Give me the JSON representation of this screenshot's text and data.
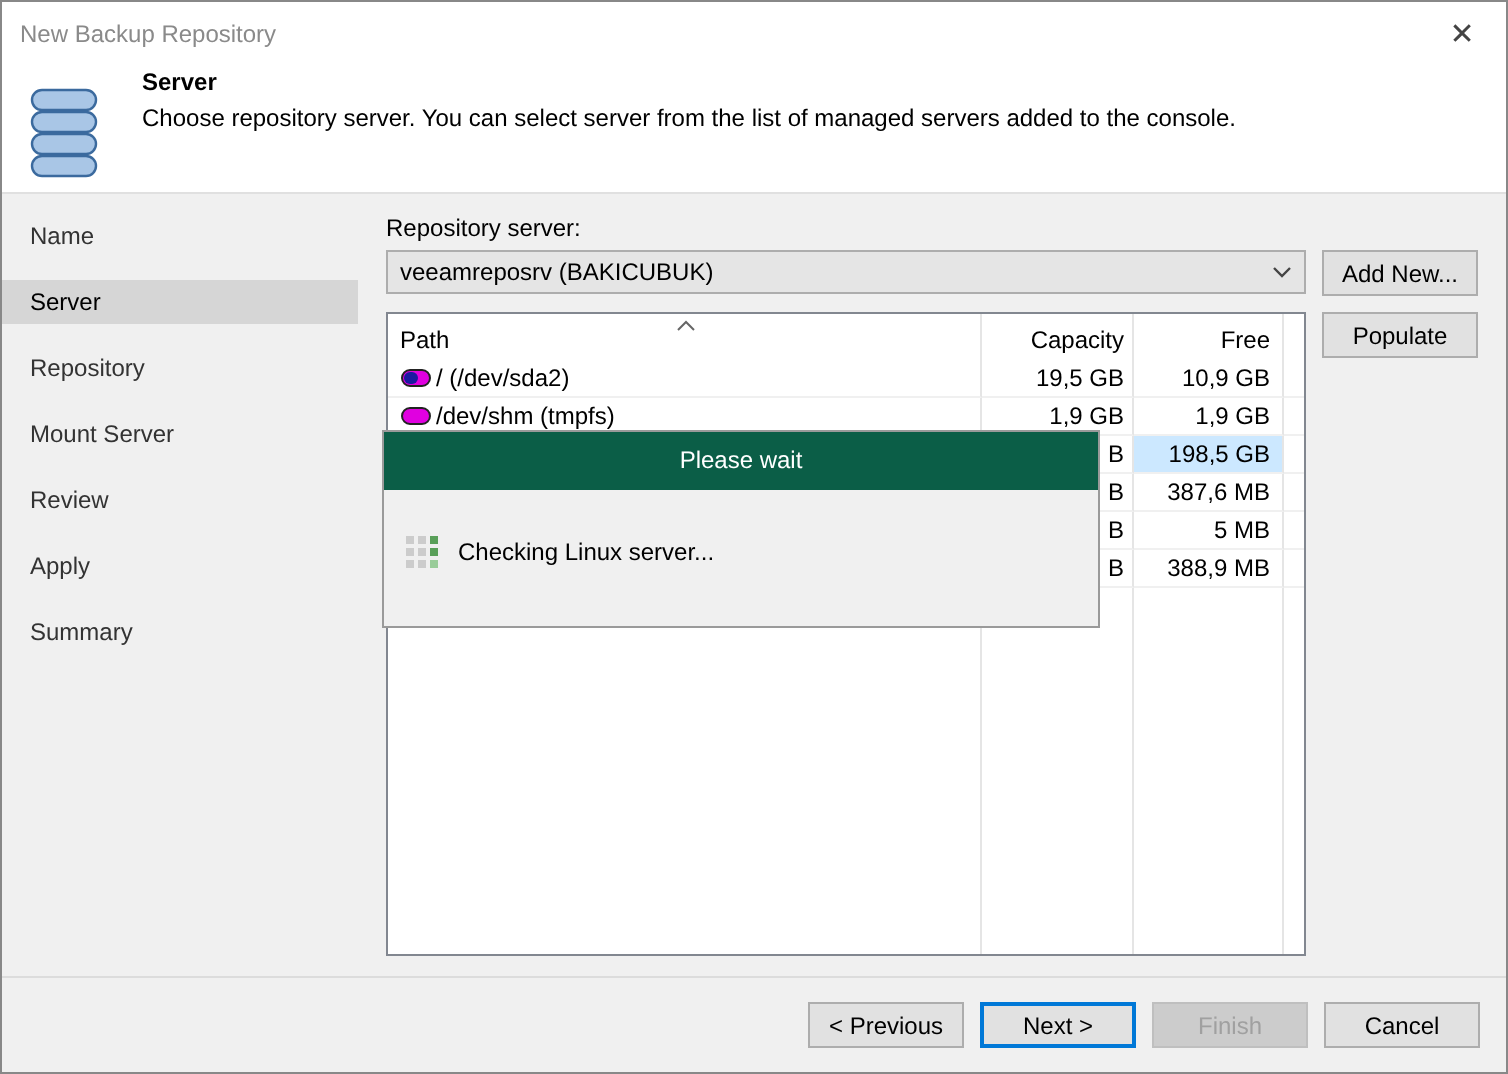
{
  "window": {
    "title": "New Backup Repository",
    "close": "✕"
  },
  "header": {
    "title": "Server",
    "description": "Choose repository server. You can select server from the list of managed servers added to the console."
  },
  "sidebar": {
    "items": [
      {
        "label": "Name",
        "selected": false
      },
      {
        "label": "Server",
        "selected": true
      },
      {
        "label": "Repository",
        "selected": false
      },
      {
        "label": "Mount Server",
        "selected": false
      },
      {
        "label": "Review",
        "selected": false
      },
      {
        "label": "Apply",
        "selected": false
      },
      {
        "label": "Summary",
        "selected": false
      }
    ]
  },
  "repository_server": {
    "label": "Repository server:",
    "value": "veeamreposrv (BAKICUBUK)"
  },
  "side_buttons": [
    "Add New...",
    "Populate"
  ],
  "table": {
    "columns": [
      "Path",
      "Capacity",
      "Free"
    ],
    "rows": [
      {
        "path": "/ (/dev/sda2)",
        "kind": "system",
        "capacity": "19,5 GB",
        "free": "10,9 GB",
        "selected": false
      },
      {
        "path": "/dev/shm (tmpfs)",
        "kind": "memory",
        "capacity": "1,9 GB",
        "free": "1,9 GB",
        "selected": false
      },
      {
        "capacity": "B",
        "free": "198,5 GB",
        "selected": true
      },
      {
        "capacity": "B",
        "free": "387,6 MB",
        "selected": false
      },
      {
        "capacity": "B",
        "free": "5 MB",
        "selected": false
      },
      {
        "capacity": "B",
        "free": "388,9 MB",
        "selected": false
      }
    ]
  },
  "progress_dialog": {
    "title": "Please wait",
    "message": "Checking Linux server..."
  },
  "buttons": [
    {
      "label": "< Previous",
      "disabled": false,
      "default": false
    },
    {
      "label": "Next >",
      "disabled": false,
      "default": true
    },
    {
      "label": "Finish",
      "disabled": true,
      "default": false
    },
    {
      "label": "Cancel",
      "disabled": false,
      "default": false
    }
  ]
}
